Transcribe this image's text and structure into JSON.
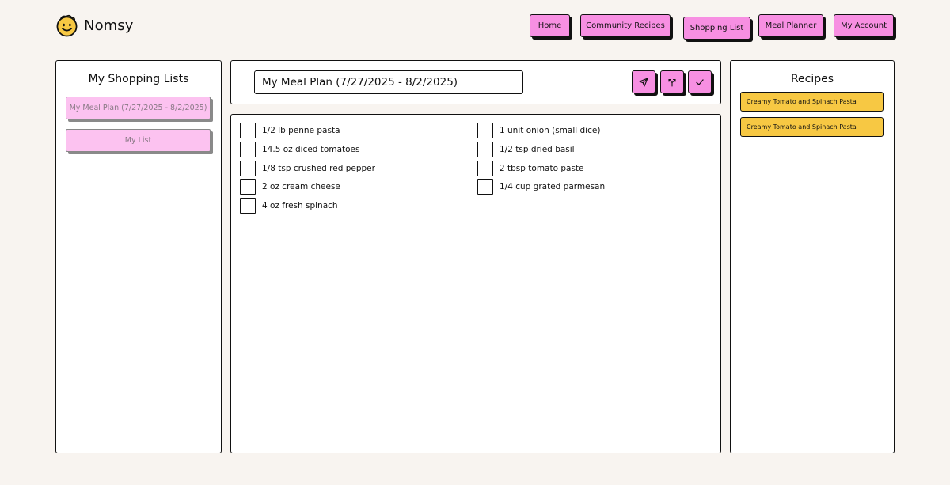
{
  "brand": {
    "name": "Nomsy",
    "logo_icon": "smiley-face-icon",
    "logo_color": "#f7c843"
  },
  "nav": [
    {
      "label": "Home"
    },
    {
      "label": "Community Recipes"
    },
    {
      "label": "Shopping List"
    },
    {
      "label": "Meal Planner"
    },
    {
      "label": "My Account"
    }
  ],
  "sidebar": {
    "title": "My Shopping Lists",
    "lists": [
      {
        "label": "My Meal Plan (7/27/2025 - 8/2/2025)"
      },
      {
        "label": "My List"
      }
    ]
  },
  "main": {
    "list_title": "My Meal Plan (7/27/2025 - 8/2/2025)",
    "actions": [
      {
        "icon": "send-icon"
      },
      {
        "icon": "merge-icon"
      },
      {
        "icon": "check-icon"
      }
    ],
    "items_left": [
      "1/2 lb penne pasta",
      "14.5 oz diced tomatoes",
      "1/8 tsp crushed red pepper",
      "2 oz cream cheese",
      "4 oz fresh spinach"
    ],
    "items_right": [
      "1 unit onion (small dice)",
      "1/2 tsp dried basil",
      "2 tbsp tomato paste",
      "1/4 cup grated parmesan"
    ]
  },
  "recipes": {
    "title": "Recipes",
    "items": [
      "Creamy Tomato and Spinach Pasta",
      "Creamy Tomato and Spinach Pasta"
    ]
  },
  "colors": {
    "accent": "#f78fe2",
    "accent_light": "#fcc2f0",
    "chip": "#f7c843",
    "background": "#f8f4f0"
  }
}
